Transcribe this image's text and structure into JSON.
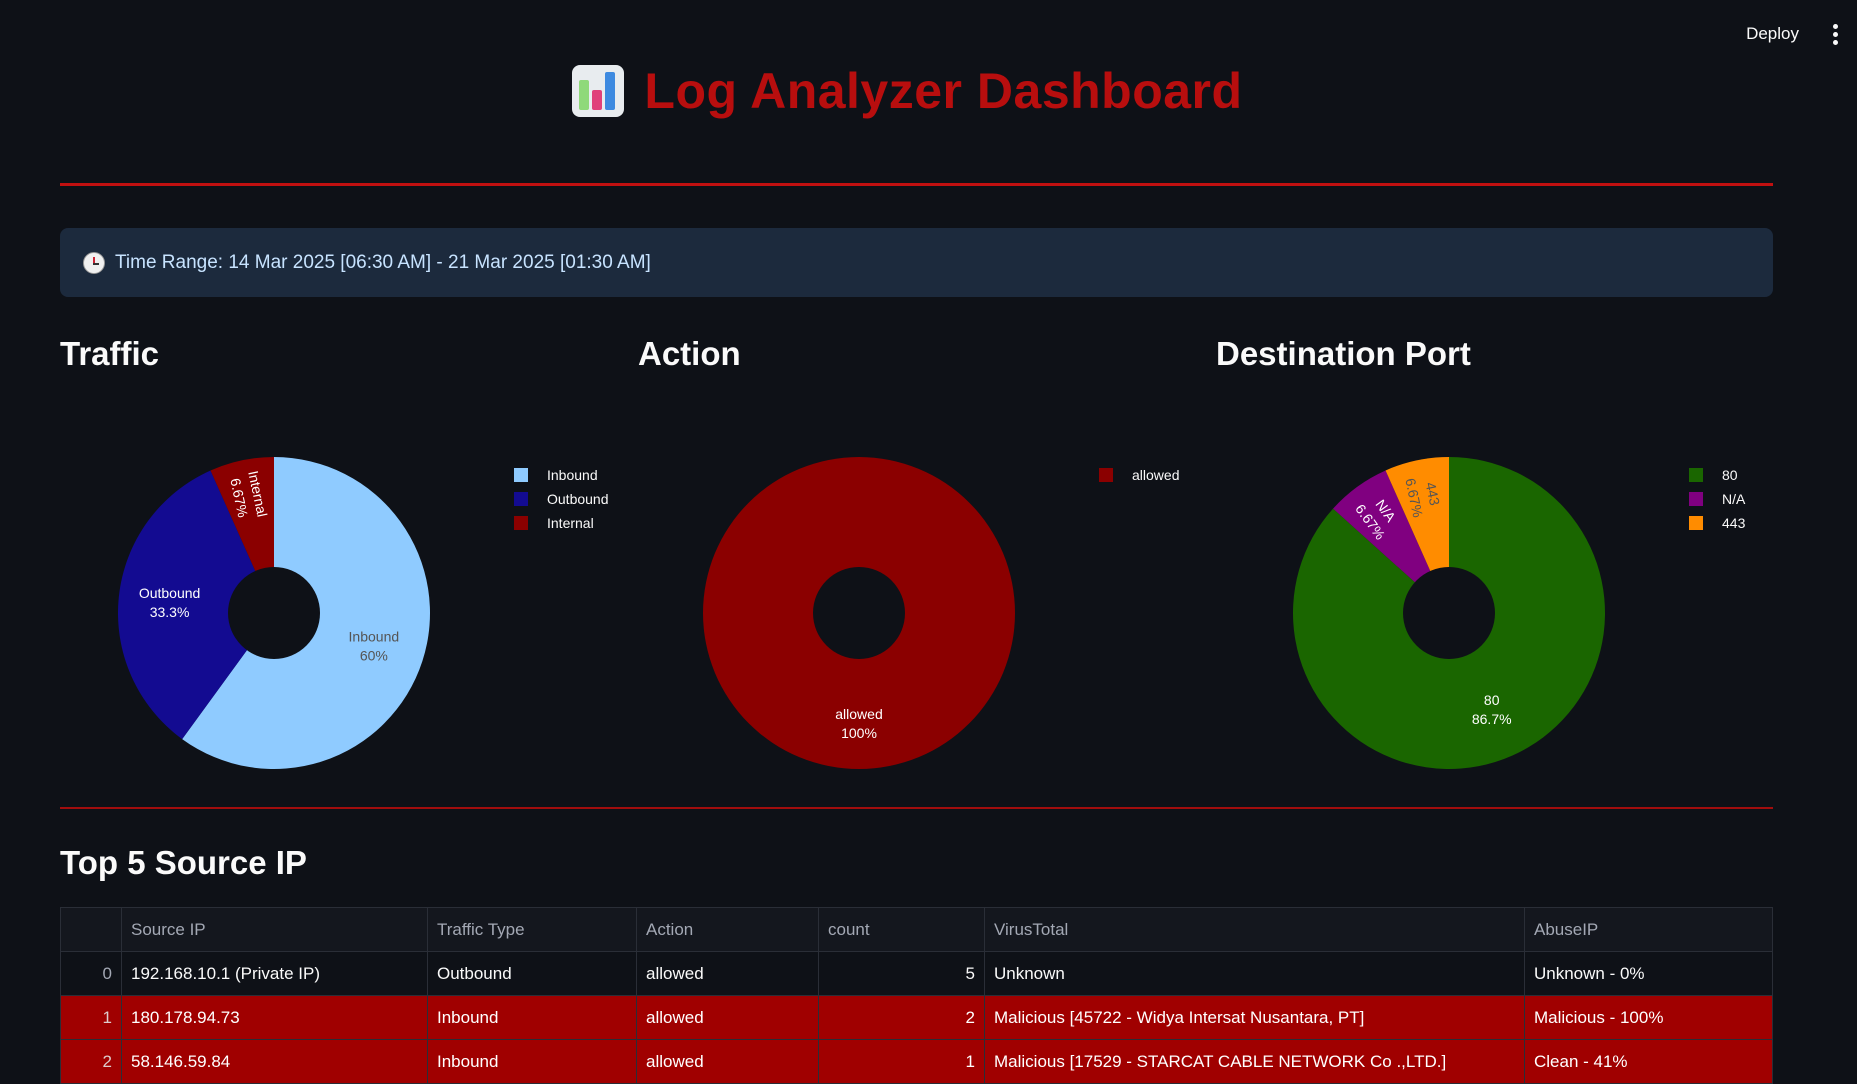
{
  "toolbar": {
    "deploy_label": "Deploy"
  },
  "header": {
    "title": "Log Analyzer Dashboard",
    "icon": "bar-chart-icon"
  },
  "info": {
    "time_range": "Time Range: 14 Mar 2025 [06:30 AM] - 21 Mar 2025 [01:30 AM]",
    "icon": "clock-icon"
  },
  "sections": {
    "traffic": "Traffic",
    "action": "Action",
    "dest_port": "Destination Port",
    "top_ips": "Top 5 Source IP"
  },
  "chart_data": [
    {
      "type": "pie",
      "title": "Traffic",
      "hole": true,
      "labels": [
        "Inbound",
        "Outbound",
        "Internal"
      ],
      "values": [
        60,
        33.3,
        6.67
      ],
      "slice_labels": [
        "Inbound\n60%",
        "Outbound\n33.3%",
        "Internal\n6.67%"
      ],
      "colors": [
        "#8fcbff",
        "#130b91",
        "#8b0000"
      ],
      "label_colors": [
        "#555555",
        "#ffffff",
        "#ffffff"
      ],
      "legend": "right"
    },
    {
      "type": "pie",
      "title": "Action",
      "hole": true,
      "labels": [
        "allowed"
      ],
      "values": [
        100
      ],
      "slice_labels": [
        "allowed\n100%"
      ],
      "colors": [
        "#8b0000"
      ],
      "label_colors": [
        "#ffffff"
      ],
      "legend": "right"
    },
    {
      "type": "pie",
      "title": "Destination Port",
      "hole": true,
      "labels": [
        "80",
        "N/A",
        "443"
      ],
      "values": [
        86.7,
        6.67,
        6.67
      ],
      "slice_labels": [
        "80\n86.7%",
        "N/A\n6.67%",
        "443\n6.67%"
      ],
      "colors": [
        "#1a6600",
        "#800080",
        "#ff8c00"
      ],
      "label_colors": [
        "#ffffff",
        "#ffffff",
        "#555555"
      ],
      "legend": "right"
    }
  ],
  "table": {
    "columns": [
      "",
      "Source IP",
      "Traffic Type",
      "Action",
      "count",
      "VirusTotal",
      "AbuseIP"
    ],
    "rows": [
      {
        "idx": "0",
        "ip": "192.168.10.1 (Private IP)",
        "traffic": "Outbound",
        "action": "allowed",
        "count": "5",
        "vt": "Unknown",
        "abuse": "Unknown - 0%"
      },
      {
        "idx": "1",
        "ip": "180.178.94.73",
        "traffic": "Inbound",
        "action": "allowed",
        "count": "2",
        "vt": "Malicious [45722 - Widya Intersat Nusantara, PT]",
        "abuse": "Malicious - 100%"
      },
      {
        "idx": "2",
        "ip": "58.146.59.84",
        "traffic": "Inbound",
        "action": "allowed",
        "count": "1",
        "vt": "Malicious [17529 - STARCAT CABLE NETWORK Co .,LTD.]",
        "abuse": "Clean - 41%"
      }
    ]
  }
}
